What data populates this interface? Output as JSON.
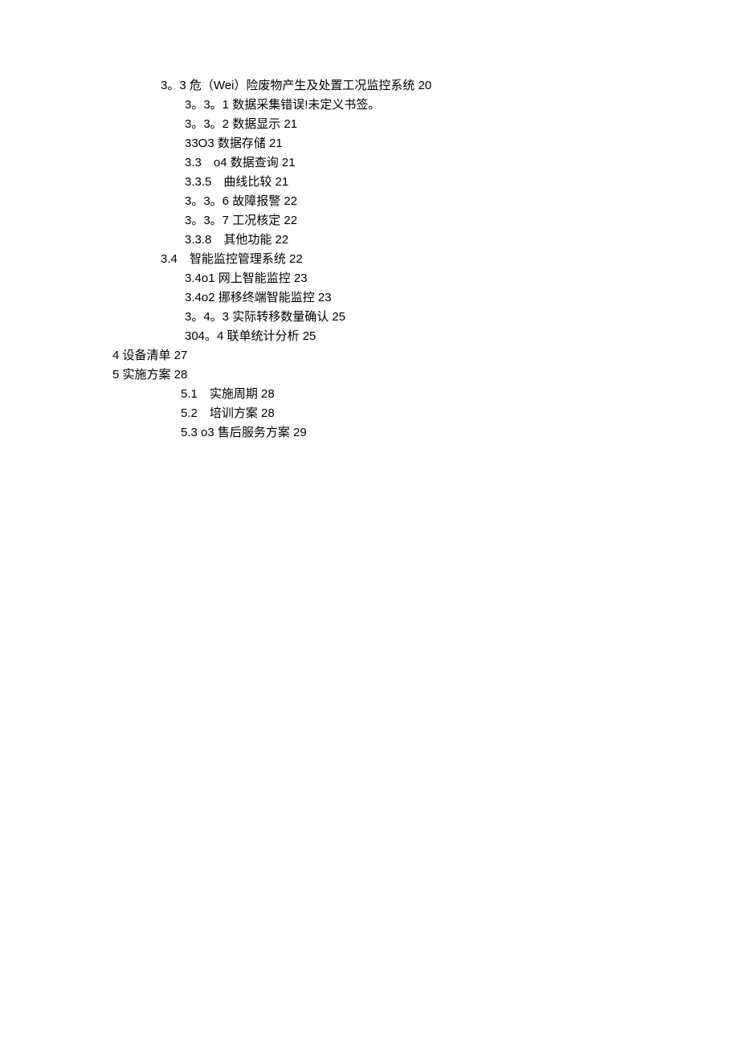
{
  "toc": {
    "entries": [
      {
        "level": "l1",
        "text": "3。3 危（Wei）险废物产生及处置工况监控系统 20"
      },
      {
        "level": "l2",
        "text": "3。3。1 数据采集错误!未定义书签。"
      },
      {
        "level": "l2",
        "text": "3。3。2 数据显示 21"
      },
      {
        "level": "l2",
        "text": "33O3 数据存储 21"
      },
      {
        "level": "l2",
        "text": "3.3　o4 数据查询 21"
      },
      {
        "level": "l2",
        "text": "3.3.5　曲线比较 21"
      },
      {
        "level": "l2",
        "text": "3。3。6 故障报警 22"
      },
      {
        "level": "l2",
        "text": "3。3。7 工况核定 22"
      },
      {
        "level": "l2",
        "text": "3.3.8　其他功能 22"
      },
      {
        "level": "l1",
        "text": "3.4　智能监控管理系统 22"
      },
      {
        "level": "l2",
        "text": "3.4o1 网上智能监控 23"
      },
      {
        "level": "l2",
        "text": "3.4o2 挪移终端智能监控 23"
      },
      {
        "level": "l2",
        "text": "3。4。3 实际转移数量确认 25"
      },
      {
        "level": "l2",
        "text": "304。4 联单统计分析 25"
      },
      {
        "level": "l0",
        "text": "4 设备清单 27"
      },
      {
        "level": "l0",
        "text": "5 实施方案 28"
      },
      {
        "level": "l1-alt",
        "text": "5.1　实施周期 28"
      },
      {
        "level": "l1-alt",
        "text": "5.2　培训方案 28"
      },
      {
        "level": "l1-alt",
        "text": "5.3 o3 售后服务方案 29"
      }
    ]
  }
}
